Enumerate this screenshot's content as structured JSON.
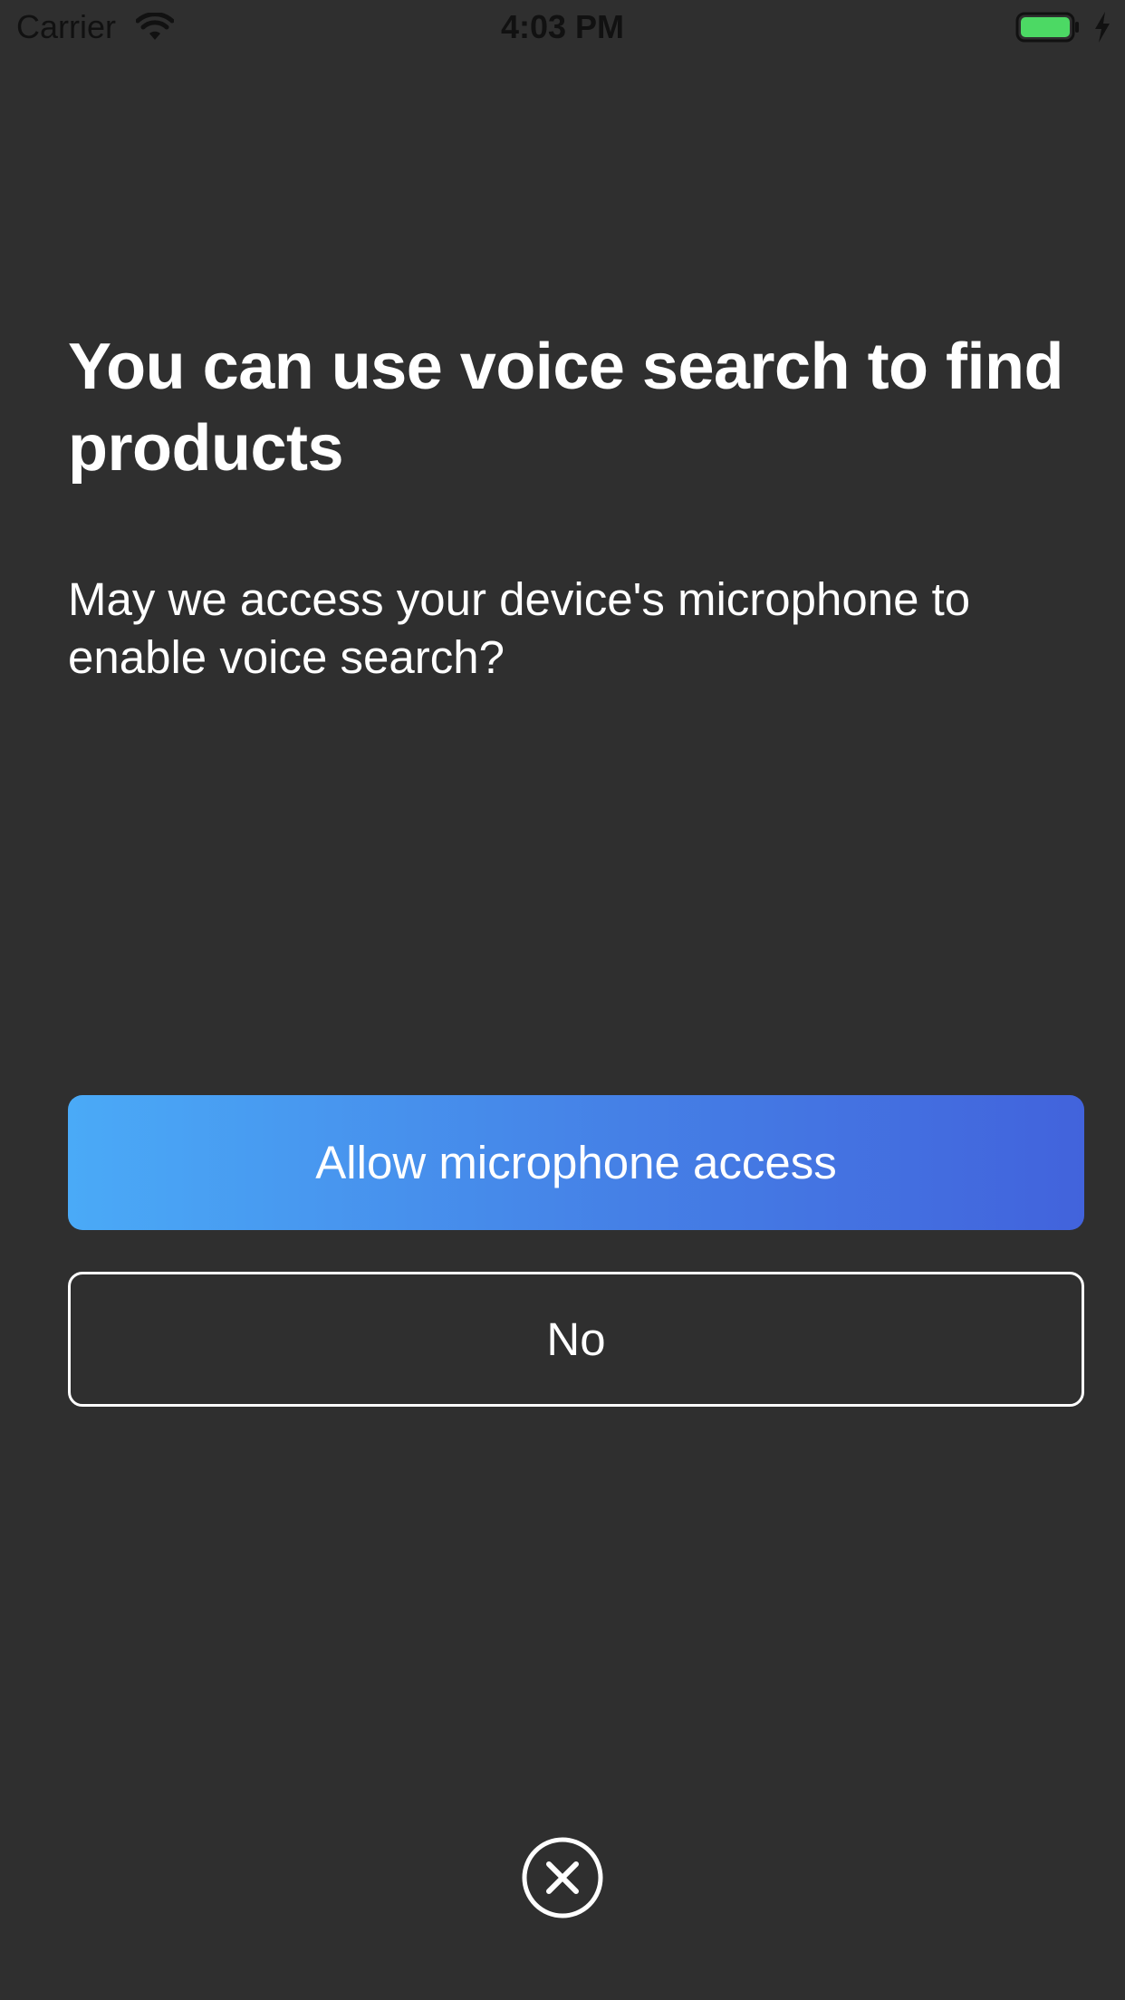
{
  "status_bar": {
    "carrier": "Carrier",
    "time": "4:03 PM",
    "battery_color": "#4cd964"
  },
  "prompt": {
    "headline": "You can use voice search to find products",
    "message": "May we access your device's microphone to enable voice search?"
  },
  "actions": {
    "allow_label": "Allow microphone access",
    "deny_label": "No",
    "close_icon": "close-circle-icon"
  },
  "theme": {
    "background": "#2f2f2f",
    "gradient_start": "#4aaaf7",
    "gradient_end": "#4263dc",
    "text": "#ffffff"
  }
}
